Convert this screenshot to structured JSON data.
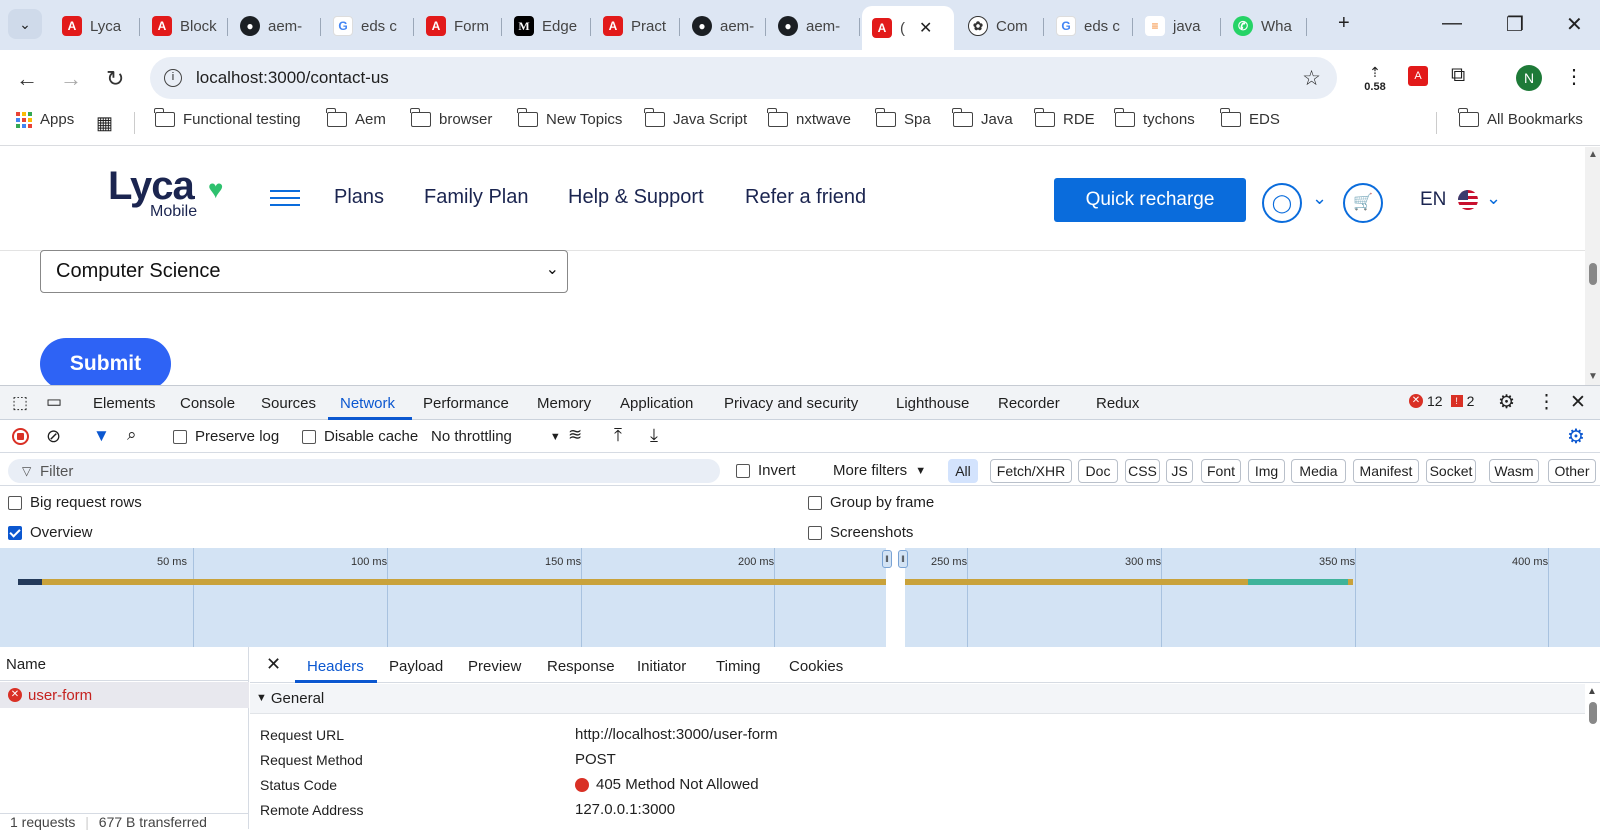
{
  "browser": {
    "tabs": [
      {
        "title": "Lyca",
        "icon": "adobe-icon"
      },
      {
        "title": "Block",
        "icon": "adobe-icon"
      },
      {
        "title": "aem-",
        "icon": "github-icon"
      },
      {
        "title": "eds c",
        "icon": "google-icon"
      },
      {
        "title": "Form",
        "icon": "adobe-icon"
      },
      {
        "title": "Edge",
        "icon": "medium-icon"
      },
      {
        "title": "Pract",
        "icon": "adobe-icon"
      },
      {
        "title": "aem-",
        "icon": "github-icon"
      },
      {
        "title": "aem-",
        "icon": "github-icon"
      },
      {
        "title": "(",
        "icon": "adobe-icon"
      },
      {
        "title": "Com",
        "icon": "chatgpt-icon"
      },
      {
        "title": "eds c",
        "icon": "google-icon"
      },
      {
        "title": "java",
        "icon": "stackoverflow-icon"
      },
      {
        "title": "Wha",
        "icon": "whatsapp-icon"
      }
    ],
    "url": "localhost:3000/contact-us",
    "zoom": "0.58",
    "profile_initial": "N",
    "bookmarks": [
      "Apps",
      "Functional testing",
      "Aem",
      "browser",
      "New Topics",
      "Java Script",
      "nxtwave",
      "Spa",
      "Java",
      "RDE",
      "tychons",
      "EDS"
    ],
    "all_bookmarks": "All Bookmarks"
  },
  "site": {
    "logo_top": "Lyca",
    "logo_bottom": "Mobile",
    "nav": [
      "Plans",
      "Family Plan",
      "Help & Support",
      "Refer a friend"
    ],
    "quick_recharge": "Quick recharge",
    "language": "EN",
    "select_value": "Computer Science",
    "submit": "Submit"
  },
  "devtools": {
    "tabs": [
      "Elements",
      "Console",
      "Sources",
      "Network",
      "Performance",
      "Memory",
      "Application",
      "Privacy and security",
      "Lighthouse",
      "Recorder",
      "Redux"
    ],
    "active_tab": "Network",
    "errors": "12",
    "warnings": "2",
    "preserve_log": "Preserve log",
    "disable_cache": "Disable cache",
    "throttling": "No throttling",
    "filter_placeholder": "Filter",
    "invert": "Invert",
    "more_filters": "More filters",
    "type_filters": [
      "All",
      "Fetch/XHR",
      "Doc",
      "CSS",
      "JS",
      "Font",
      "Img",
      "Media",
      "Manifest",
      "Socket",
      "Wasm",
      "Other"
    ],
    "big_request_rows": "Big request rows",
    "group_by_frame": "Group by frame",
    "overview": "Overview",
    "screenshots": "Screenshots",
    "timeline_ticks": [
      "50 ms",
      "100 ms",
      "150 ms",
      "200 ms",
      "250 ms",
      "300 ms",
      "350 ms",
      "400 ms"
    ],
    "name_header": "Name",
    "request_name": "user-form",
    "summary": "1 requests",
    "transferred": "677 B transferred",
    "detail_tabs": [
      "Headers",
      "Payload",
      "Preview",
      "Response",
      "Initiator",
      "Timing",
      "Cookies"
    ],
    "section": "General",
    "general": [
      {
        "k": "Request URL",
        "v": "http://localhost:3000/user-form"
      },
      {
        "k": "Request Method",
        "v": "POST"
      },
      {
        "k": "Status Code",
        "v": "405 Method Not Allowed"
      },
      {
        "k": "Remote Address",
        "v": "127.0.0.1:3000"
      }
    ]
  }
}
